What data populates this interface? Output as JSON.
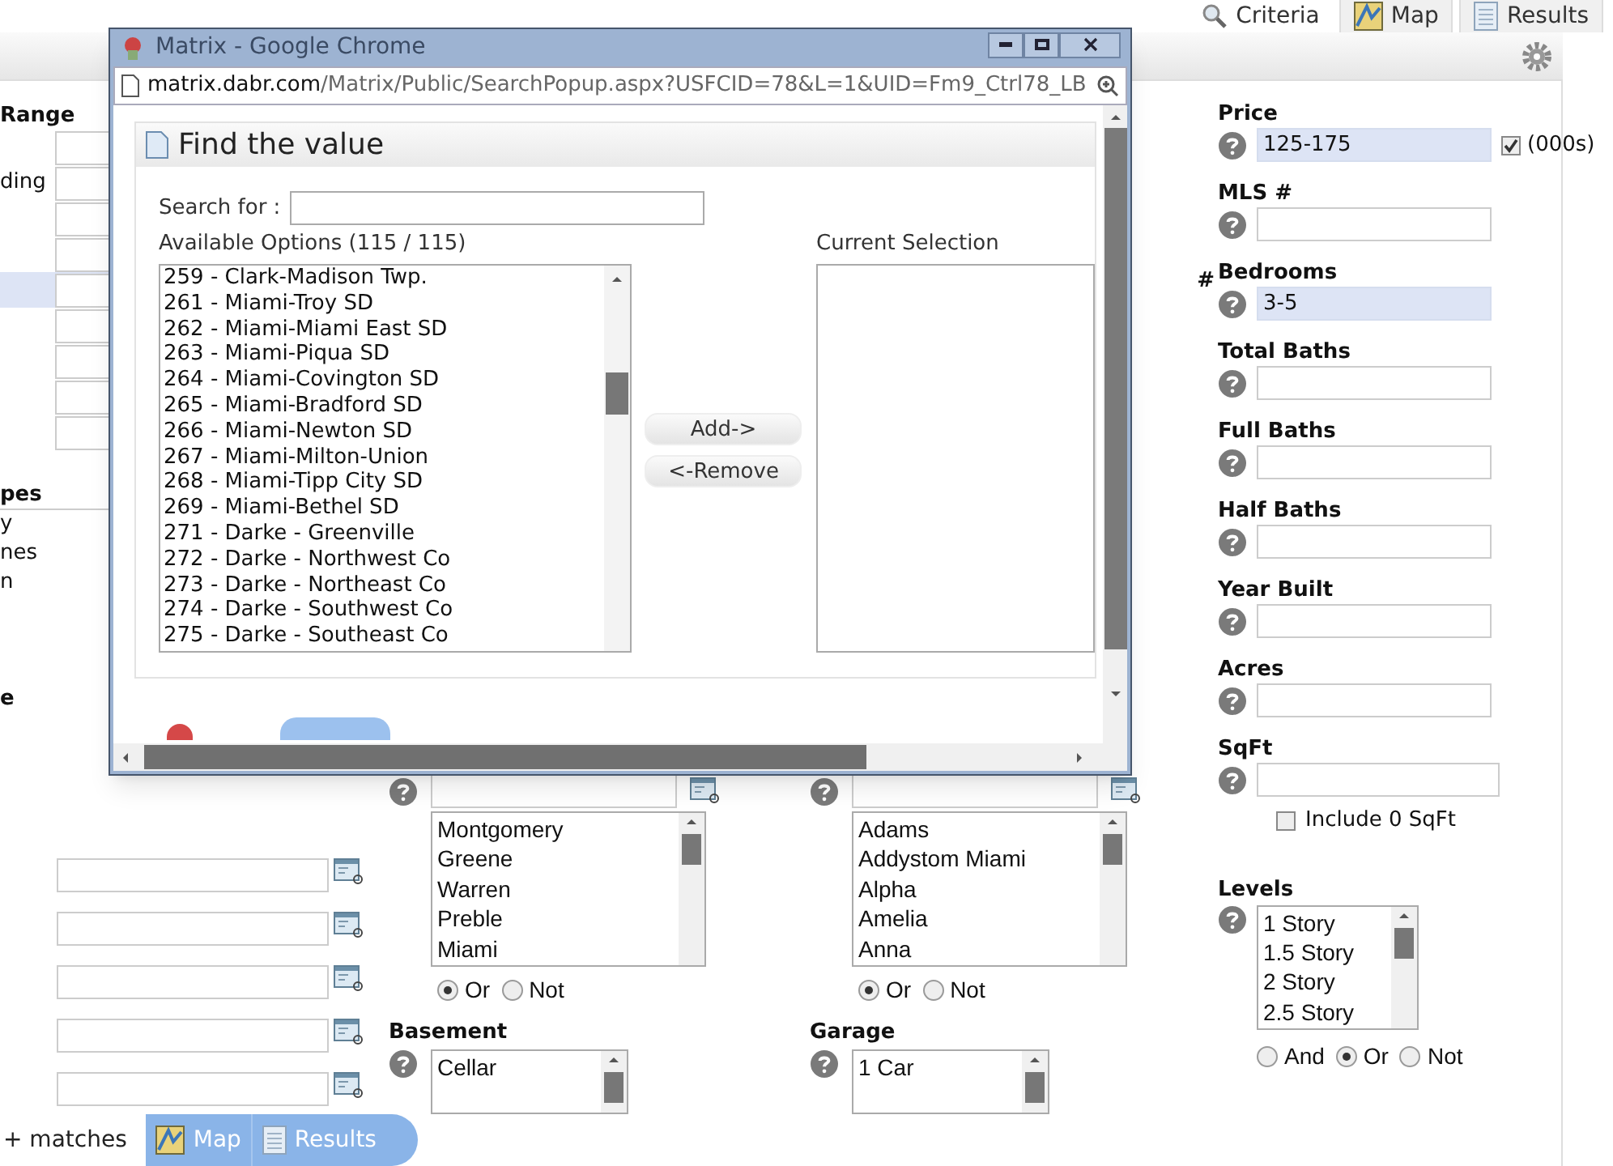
{
  "top_tabs": [
    {
      "label": "Criteria",
      "kind": "search",
      "selected": true
    },
    {
      "label": "Map",
      "kind": "map",
      "selected": false
    },
    {
      "label": "Results",
      "kind": "list",
      "selected": false
    }
  ],
  "left_column": {
    "heading": "Range",
    "field_label": "ding",
    "group_heading": "pes",
    "group_items": [
      "y",
      "nes",
      "n"
    ],
    "last_heading": "e"
  },
  "middle_fragment": "#",
  "county": {
    "options": [
      "Montgomery",
      "Greene",
      "Warren",
      "Preble",
      "Miami"
    ],
    "logic": [
      {
        "label": "Or",
        "selected": true
      },
      {
        "label": "Not",
        "selected": false
      }
    ]
  },
  "municipality": {
    "options": [
      "Adams",
      "Addystom Miami",
      "Alpha",
      "Amelia",
      "Anna"
    ],
    "logic": [
      {
        "label": "Or",
        "selected": true
      },
      {
        "label": "Not",
        "selected": false
      }
    ]
  },
  "basement": {
    "label": "Basement",
    "options": [
      "Cellar"
    ]
  },
  "garage": {
    "label": "Garage",
    "options": [
      "1 Car"
    ]
  },
  "criteria_fields": [
    {
      "label": "Price",
      "value": "125-175",
      "highlighted": true,
      "checkbox": {
        "label": "(000s)",
        "checked": true
      }
    },
    {
      "label": "MLS #",
      "highlighted": false
    },
    {
      "label": "Bedrooms",
      "value": "3-5",
      "highlighted": true
    },
    {
      "label": "Total Baths",
      "highlighted": false
    },
    {
      "label": "Full Baths",
      "highlighted": false
    },
    {
      "label": "Half Baths",
      "highlighted": false
    },
    {
      "label": "Year Built",
      "highlighted": false
    },
    {
      "label": "Acres",
      "highlighted": false
    },
    {
      "label": "SqFt",
      "highlighted": false
    }
  ],
  "sqft_include": {
    "label": "Include 0 SqFt",
    "checked": false
  },
  "levels": {
    "label": "Levels",
    "options": [
      "1 Story",
      "1.5 Story",
      "2 Story",
      "2.5 Story"
    ],
    "logic": [
      {
        "label": "And",
        "selected": false
      },
      {
        "label": "Or",
        "selected": true
      },
      {
        "label": "Not",
        "selected": false
      }
    ]
  },
  "bottom_bar": {
    "matches": "+ matches",
    "tabs": [
      {
        "label": "Map",
        "kind": "map"
      },
      {
        "label": "Results",
        "kind": "list"
      }
    ]
  },
  "popup": {
    "window_title": "Matrix - Google Chrome",
    "url_host": "matrix.dabr.com",
    "url_path": "/Matrix/Public/SearchPopup.aspx?USFCID=78&L=1&UID=Fm9_Ctrl78_LB",
    "heading": "Find the value",
    "search_label": "Search for :",
    "available_label": "Available Options (115 / 115)",
    "current_label": "Current Selection",
    "options": [
      "259 - Clark-Madison Twp.",
      "261 - Miami-Troy SD",
      "262 - Miami-Miami East SD",
      "263 - Miami-Piqua SD",
      "264 - Miami-Covington SD",
      "265 - Miami-Bradford SD",
      "266 - Miami-Newton SD",
      "267 - Miami-Milton-Union",
      "268 - Miami-Tipp City SD",
      "269 - Miami-Bethel SD",
      "271 - Darke - Greenville",
      "272 - Darke - Northwest Co",
      "273 - Darke - Northeast Co",
      "274 - Darke - Southwest Co",
      "275 - Darke - Southeast Co"
    ],
    "buttons": [
      "Add->",
      "<-Remove"
    ]
  }
}
